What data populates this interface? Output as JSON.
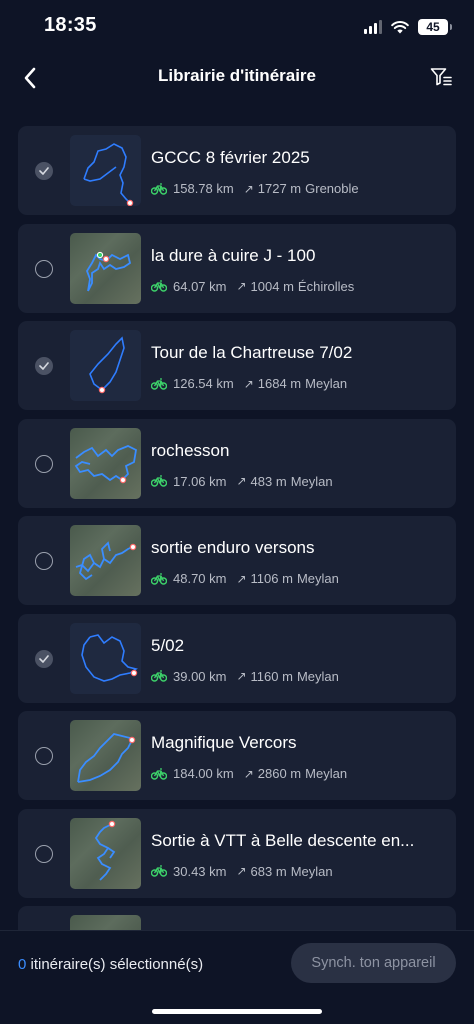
{
  "status": {
    "time": "18:35",
    "battery": "45"
  },
  "nav": {
    "title": "Librairie d'itinéraire",
    "back_icon": "chevron-left-icon",
    "filter_icon": "filter-icon"
  },
  "colors": {
    "accent": "#3a8dff",
    "bike": "#3dd26a",
    "route": "#2f7dff",
    "marker": "#ff6b6b",
    "card": "#1a2134",
    "background": "#0e1426"
  },
  "routes": [
    {
      "name": "GCCC 8 février 2025",
      "distance": "158.78 km",
      "elevation": "1727 m",
      "location": "Grenoble",
      "checked": true,
      "thumb": "dark"
    },
    {
      "name": "la dure à cuire J - 100",
      "distance": "64.07 km",
      "elevation": "1004 m",
      "location": "Échirolles",
      "checked": false,
      "thumb": "map"
    },
    {
      "name": "Tour de la Chartreuse 7/02",
      "distance": "126.54 km",
      "elevation": "1684 m",
      "location": "Meylan",
      "checked": true,
      "thumb": "dark"
    },
    {
      "name": "rochesson",
      "distance": "17.06 km",
      "elevation": "483 m",
      "location": "Meylan",
      "checked": false,
      "thumb": "map"
    },
    {
      "name": "sortie enduro versons",
      "distance": "48.70 km",
      "elevation": "1106 m",
      "location": "Meylan",
      "checked": false,
      "thumb": "map"
    },
    {
      "name": "5/02",
      "distance": "39.00 km",
      "elevation": "1160 m",
      "location": "Meylan",
      "checked": true,
      "thumb": "dark"
    },
    {
      "name": "Magnifique Vercors",
      "distance": "184.00 km",
      "elevation": "2860 m",
      "location": "Meylan",
      "checked": false,
      "thumb": "map"
    },
    {
      "name": "Sortie à VTT à Belle descente en...",
      "distance": "30.43 km",
      "elevation": "683 m",
      "location": "Meylan",
      "checked": false,
      "thumb": "map"
    }
  ],
  "footer": {
    "count": "0",
    "count_label": " itinéraire(s) sélectionné(s)",
    "sync_label": "Synch. ton appareil"
  }
}
